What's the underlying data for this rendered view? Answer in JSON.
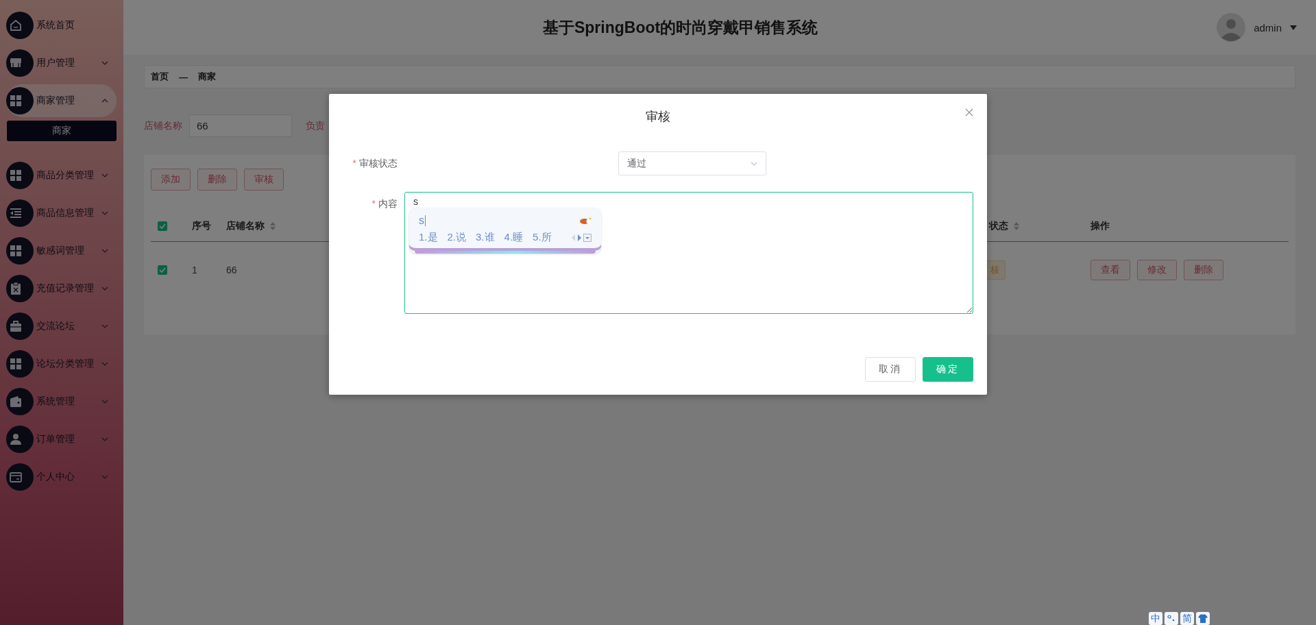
{
  "sidebar": {
    "items": [
      {
        "label": "系统首页",
        "kind": "link",
        "selected": false
      },
      {
        "label": "用户管理",
        "kind": "menu",
        "expanded": false,
        "selected": false
      },
      {
        "label": "商家管理",
        "kind": "menu",
        "expanded": true,
        "selected": true,
        "children": [
          {
            "label": "商家",
            "selected": true
          }
        ]
      },
      {
        "label": "商品分类管理",
        "kind": "menu",
        "expanded": false,
        "selected": false
      },
      {
        "label": "商品信息管理",
        "kind": "menu",
        "expanded": false,
        "selected": false
      },
      {
        "label": "敏感词管理",
        "kind": "menu",
        "expanded": false,
        "selected": false
      },
      {
        "label": "充值记录管理",
        "kind": "menu",
        "expanded": false,
        "selected": false
      },
      {
        "label": "交流论坛",
        "kind": "menu",
        "expanded": false,
        "selected": false
      },
      {
        "label": "论坛分类管理",
        "kind": "menu",
        "expanded": false,
        "selected": false
      },
      {
        "label": "系统管理",
        "kind": "menu",
        "expanded": false,
        "selected": false
      },
      {
        "label": "订单管理",
        "kind": "menu",
        "expanded": false,
        "selected": false
      },
      {
        "label": "个人中心",
        "kind": "menu",
        "expanded": false,
        "selected": false
      }
    ]
  },
  "header": {
    "title": "基于SpringBoot的时尚穿戴甲销售系统",
    "user": "admin"
  },
  "breadcrumb": [
    "首页",
    "—",
    "商家"
  ],
  "search": {
    "fields": [
      {
        "label": "店铺名称",
        "value": "66"
      }
    ],
    "next_label": "负责"
  },
  "table": {
    "toolbar": [
      "添加",
      "删除",
      "审核"
    ],
    "all_checked": true,
    "columns": [
      {
        "label": "序号",
        "sortable": false
      },
      {
        "label": "店铺名称",
        "sortable": true
      },
      {
        "label": "状态",
        "sortable": true
      },
      {
        "label": "操作",
        "sortable": false
      }
    ],
    "rows": [
      {
        "checked": true,
        "cells": [
          "1",
          "66"
        ],
        "status": "核",
        "actions": [
          "查看",
          "修改",
          "删除"
        ]
      }
    ]
  },
  "dialog": {
    "title": "审核",
    "fields": [
      {
        "kind": "select",
        "mark": "*",
        "label": "审核状态",
        "value": "通过"
      },
      {
        "kind": "textarea",
        "mark": "*",
        "label": "内容",
        "value": "s"
      }
    ],
    "buttons": [
      {
        "label": "取消",
        "kind": "default"
      },
      {
        "label": "确定",
        "kind": "primary"
      }
    ]
  },
  "ime": {
    "composition": "s",
    "candidates": [
      "1.是",
      "2.说",
      "3.谁",
      "4.睡",
      "5.所"
    ]
  },
  "ime_bar": {
    "mode": "中",
    "script": "简"
  }
}
